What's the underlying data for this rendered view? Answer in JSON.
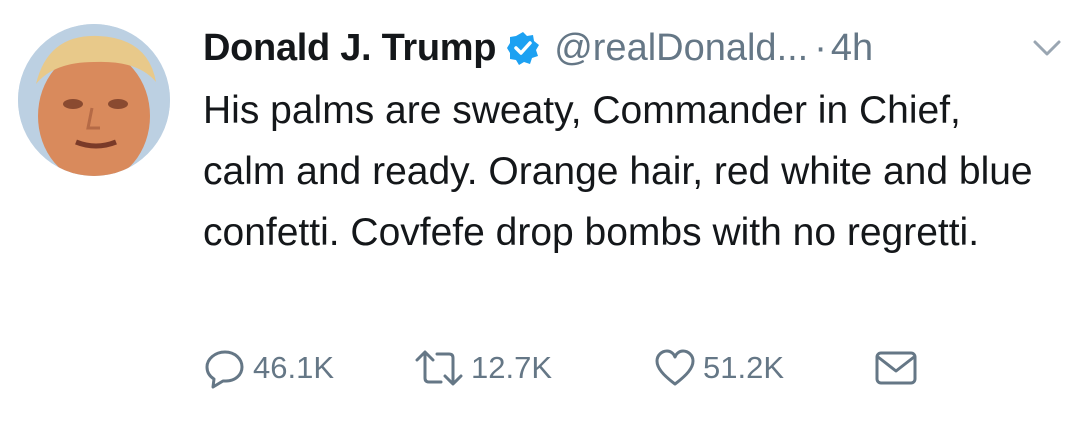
{
  "tweet": {
    "author_name": "Donald J. Trump",
    "handle": "@realDonald...",
    "separator": "·",
    "time": "4h",
    "text": "His palms are sweaty, Commander in Chief, calm and ready. Orange hair, red white and blue confetti. Covfefe drop bombs with no regretti.",
    "verified_icon": "verified-badge-icon",
    "menu_icon": "chevron-down-icon"
  },
  "actions": {
    "replies": "46.1K",
    "retweets": "12.7K",
    "likes": "51.2K",
    "icons": [
      "reply-icon",
      "retweet-icon",
      "like-icon",
      "direct-message-icon"
    ]
  },
  "colors": {
    "name": "#14171a",
    "secondary": "#657786",
    "verified": "#1da1f2",
    "background": "#ffffff"
  }
}
